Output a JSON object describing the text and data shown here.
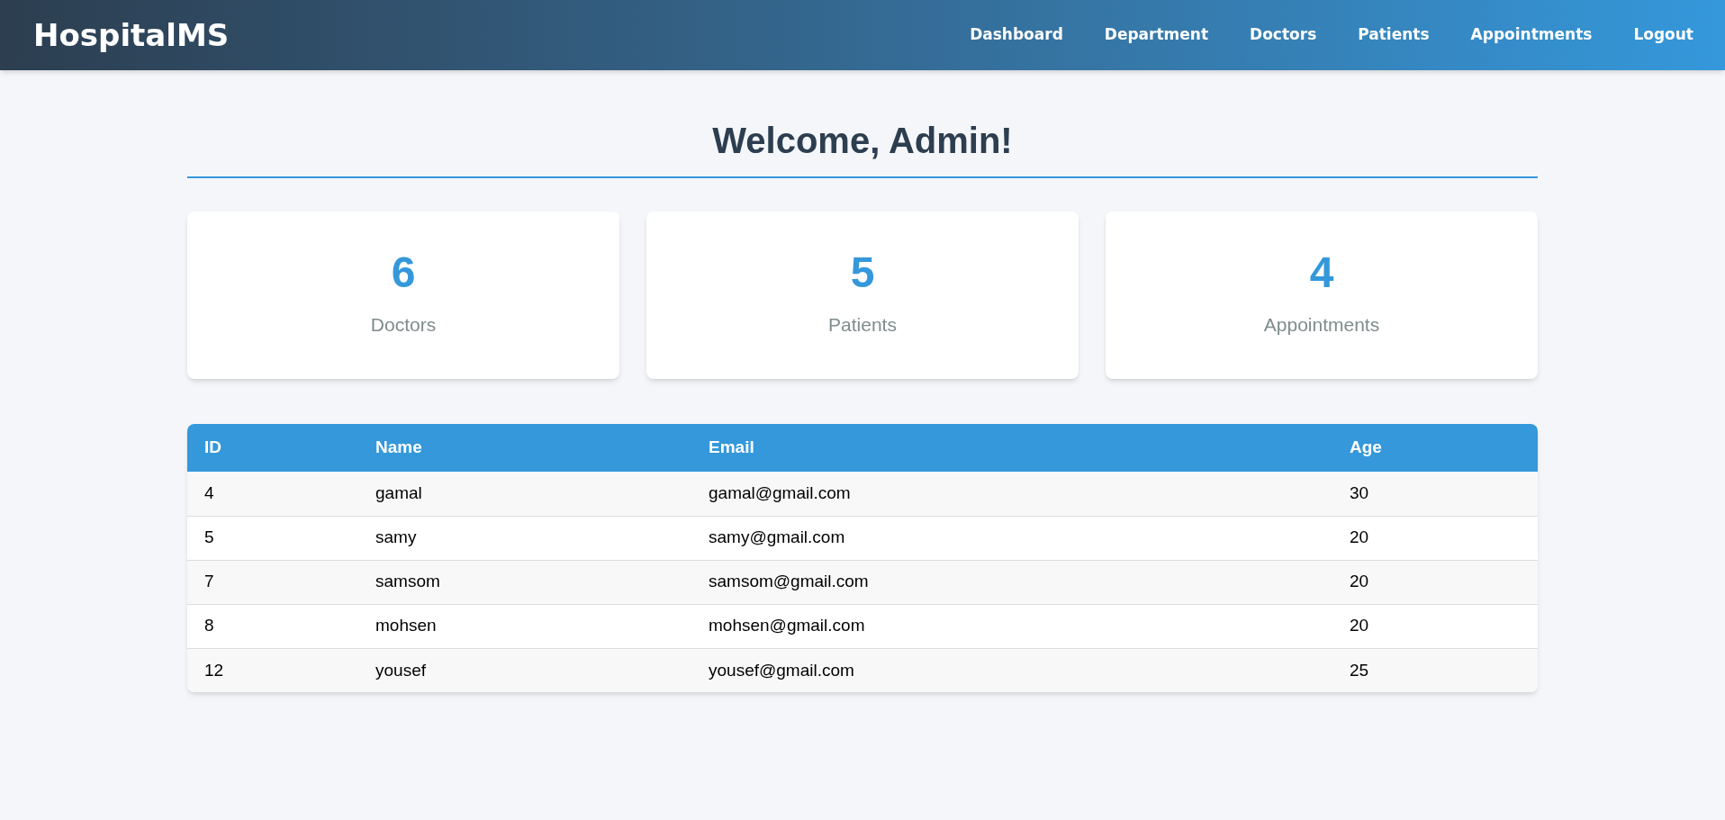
{
  "navbar": {
    "brand": "HospitalMS",
    "links": [
      "Dashboard",
      "Department",
      "Doctors",
      "Patients",
      "Appointments",
      "Logout"
    ]
  },
  "heading": "Welcome, Admin!",
  "stats": [
    {
      "value": "6",
      "label": "Doctors"
    },
    {
      "value": "5",
      "label": "Patients"
    },
    {
      "value": "4",
      "label": "Appointments"
    }
  ],
  "table": {
    "columns": [
      "ID",
      "Name",
      "Email",
      "Age"
    ],
    "rows": [
      [
        "4",
        "gamal",
        "gamal@gmail.com",
        "30"
      ],
      [
        "5",
        "samy",
        "samy@gmail.com",
        "20"
      ],
      [
        "7",
        "samsom",
        "samsom@gmail.com",
        "20"
      ],
      [
        "8",
        "mohsen",
        "mohsen@gmail.com",
        "20"
      ],
      [
        "12",
        "yousef",
        "yousef@gmail.com",
        "25"
      ]
    ]
  }
}
